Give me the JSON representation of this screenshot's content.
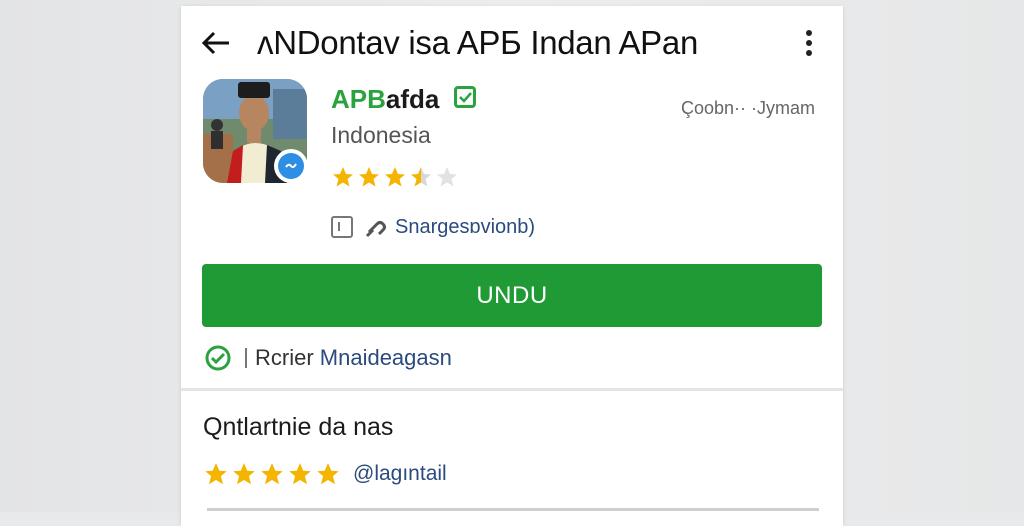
{
  "header": {
    "title": "ʌNDontav isa APБ Indan APan",
    "back_icon": "back-arrow-icon",
    "more_icon": "more-vert-icon"
  },
  "app": {
    "developer_accent": "APB",
    "developer_rest": "afda",
    "category": "Indonesia",
    "right_meta": "Çoobn·· ·Jymam",
    "rating": 3.5,
    "rating_max": 5,
    "info_label": "Snargesɒvionb)"
  },
  "install": {
    "label": "UNDU"
  },
  "protect": {
    "prefix": "Rcrier ",
    "highlight": "Mnaideagasn"
  },
  "reviews": {
    "section_title": "Qntlartnie da nas",
    "stars": 5,
    "label": "@lagıntail"
  },
  "colors": {
    "accent_green": "#1f9a34",
    "brand_green": "#2aa33f",
    "star_yellow": "#f4b400",
    "link_blue": "#2b4a7e",
    "badge_blue": "#2c8fe3"
  }
}
